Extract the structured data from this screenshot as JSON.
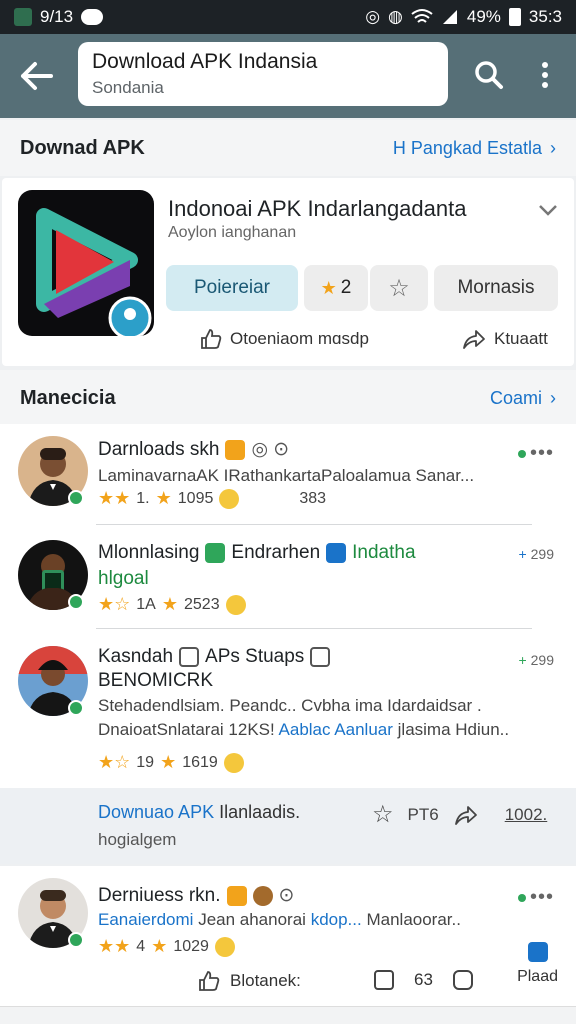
{
  "status": {
    "time": "9/13",
    "battery": "49%",
    "clock": "35:3"
  },
  "search": {
    "query": "Download APK Indansia",
    "subtitle": "Sondania"
  },
  "section1": {
    "title": "Downad APK",
    "link": "H Pangkad Estatla"
  },
  "app": {
    "title": "Indonoai APK Indarlangadanta",
    "subtitle": "Aoylon ianghanan",
    "primary_button": "Poiereiar",
    "rating_value": "2",
    "more_button": "Mornasis",
    "footer_left": "Otoeniaom mɑsdp",
    "footer_right": "Ktuaatt"
  },
  "section2": {
    "title": "Manecicia",
    "link": "Coami"
  },
  "posts": [
    {
      "title": "Darnloads skh",
      "line1": "LaminavarnaAK IRathankartaPaloalamua Sanar...",
      "rating": "1.",
      "count": "1095",
      "extra": "383"
    },
    {
      "title": "Mlonnlasing",
      "title_b": "Endrarhen",
      "title_c": "Indatha",
      "line1": "hlgoal",
      "rating": "1A",
      "count": "2523",
      "side": "299"
    },
    {
      "title": "Kasndah",
      "title_b": "APs Stuaps",
      "line1": "BENOMICRK",
      "line2": "Stehadendlsiam. Peandc.. Cvbha ima Idardaidsar .",
      "line3": "DnaioatSnlatarai 12KS!",
      "line3_link": "Aablac Aanluar",
      "line3_tail": "jlasima Hdiun..",
      "rating": "19",
      "count": "1619",
      "side": "299"
    }
  ],
  "strip": {
    "link": "Downuao APK",
    "link_tail": "Ilanlaadis.",
    "sub": "hogialgem",
    "count": "PT6",
    "right": "1002."
  },
  "last_post": {
    "title": "Derniuess rkn.",
    "line1": "Eanaierdomi",
    "line1_b": "Jean ahanorai",
    "line1_link": "kdop...",
    "line1_tail": "Manlaoorar..",
    "rating": "4",
    "count": "1029",
    "foot_left": "Blotanek:",
    "foot_count": "63",
    "foot_right": "Plaad"
  }
}
